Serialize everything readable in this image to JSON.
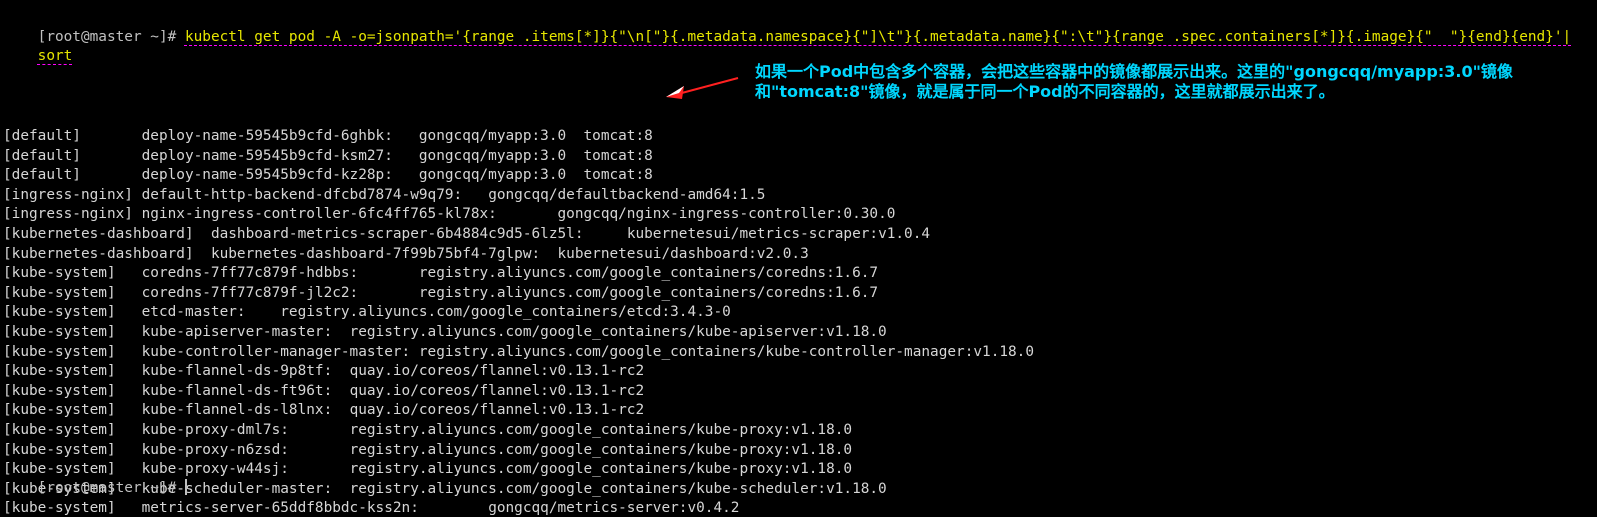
{
  "prompt": "[root@master ~]# ",
  "command_line1": "kubectl get pod -A -o=jsonpath='{range .items[*]}{\"\\n[\"}{.metadata.namespace}{\"]\\t\"}{.metadata.name}{\":\\t\"}{range .spec.containers[*]}{.image}{\"  \"}{end}{end}'|",
  "command_line2": "sort",
  "output": [
    {
      "ns": "[default]",
      "name": "deploy-name-59545b9cfd-6ghbk:",
      "images": "gongcqq/myapp:3.0  tomcat:8"
    },
    {
      "ns": "[default]",
      "name": "deploy-name-59545b9cfd-ksm27:",
      "images": "gongcqq/myapp:3.0  tomcat:8"
    },
    {
      "ns": "[default]",
      "name": "deploy-name-59545b9cfd-kz28p:",
      "images": "gongcqq/myapp:3.0  tomcat:8"
    },
    {
      "ns": "[ingress-nginx]",
      "name": "default-http-backend-dfcbd7874-w9q79:",
      "images": "gongcqq/defaultbackend-amd64:1.5"
    },
    {
      "ns": "[ingress-nginx]",
      "name": "nginx-ingress-controller-6fc4ff765-kl78x:",
      "images": "gongcqq/nginx-ingress-controller:0.30.0"
    },
    {
      "ns": "[kubernetes-dashboard]",
      "name": "dashboard-metrics-scraper-6b4884c9d5-6lz5l:",
      "images": "kubernetesui/metrics-scraper:v1.0.4"
    },
    {
      "ns": "[kubernetes-dashboard]",
      "name": "kubernetes-dashboard-7f99b75bf4-7glpw:",
      "images": "kubernetesui/dashboard:v2.0.3"
    },
    {
      "ns": "[kube-system]",
      "name": "coredns-7ff77c879f-hdbbs:",
      "images": "registry.aliyuncs.com/google_containers/coredns:1.6.7"
    },
    {
      "ns": "[kube-system]",
      "name": "coredns-7ff77c879f-jl2c2:",
      "images": "registry.aliyuncs.com/google_containers/coredns:1.6.7"
    },
    {
      "ns": "[kube-system]",
      "name": "etcd-master:",
      "images": "registry.aliyuncs.com/google_containers/etcd:3.4.3-0"
    },
    {
      "ns": "[kube-system]",
      "name": "kube-apiserver-master:",
      "images": "registry.aliyuncs.com/google_containers/kube-apiserver:v1.18.0"
    },
    {
      "ns": "[kube-system]",
      "name": "kube-controller-manager-master:",
      "images": "registry.aliyuncs.com/google_containers/kube-controller-manager:v1.18.0"
    },
    {
      "ns": "[kube-system]",
      "name": "kube-flannel-ds-9p8tf:",
      "images": "quay.io/coreos/flannel:v0.13.1-rc2"
    },
    {
      "ns": "[kube-system]",
      "name": "kube-flannel-ds-ft96t:",
      "images": "quay.io/coreos/flannel:v0.13.1-rc2"
    },
    {
      "ns": "[kube-system]",
      "name": "kube-flannel-ds-l8lnx:",
      "images": "quay.io/coreos/flannel:v0.13.1-rc2"
    },
    {
      "ns": "[kube-system]",
      "name": "kube-proxy-dml7s:",
      "images": "registry.aliyuncs.com/google_containers/kube-proxy:v1.18.0"
    },
    {
      "ns": "[kube-system]",
      "name": "kube-proxy-n6zsd:",
      "images": "registry.aliyuncs.com/google_containers/kube-proxy:v1.18.0"
    },
    {
      "ns": "[kube-system]",
      "name": "kube-proxy-w44sj:",
      "images": "registry.aliyuncs.com/google_containers/kube-proxy:v1.18.0"
    },
    {
      "ns": "[kube-system]",
      "name": "kube-scheduler-master:",
      "images": "registry.aliyuncs.com/google_containers/kube-scheduler:v1.18.0"
    },
    {
      "ns": "[kube-system]",
      "name": "metrics-server-65ddf8bbdc-kss2n:",
      "images": "gongcqq/metrics-server:v0.4.2"
    }
  ],
  "final_prompt": "[root@master ~]# ",
  "annotation": "如果一个Pod中包含多个容器，会把这些容器中的镜像都展示出来。这里的\"gongcqq/myapp:3.0\"镜像\n和\"tomcat:8\"镜像，就是属于同一个Pod的不同容器的，这里就都展示出来了。",
  "colors": {
    "command": "#e6e600",
    "annotation": "#00d7ff",
    "arrow": "#ff2020",
    "underline": "#ff00ff"
  }
}
